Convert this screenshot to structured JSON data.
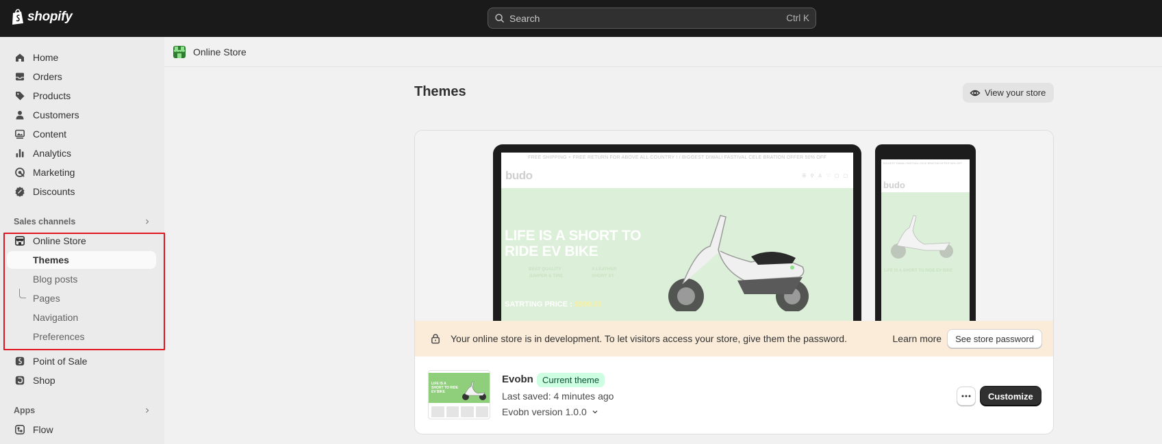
{
  "topbar": {
    "brand": "shopify",
    "search_placeholder": "Search",
    "search_shortcut": "Ctrl K"
  },
  "sidebar": {
    "items": [
      {
        "label": "Home",
        "icon": "home-icon"
      },
      {
        "label": "Orders",
        "icon": "inbox-icon"
      },
      {
        "label": "Products",
        "icon": "tag-icon"
      },
      {
        "label": "Customers",
        "icon": "person-icon"
      },
      {
        "label": "Content",
        "icon": "image-icon"
      },
      {
        "label": "Analytics",
        "icon": "bar-chart-icon"
      },
      {
        "label": "Marketing",
        "icon": "target-icon"
      },
      {
        "label": "Discounts",
        "icon": "discount-icon"
      }
    ],
    "sales_channels_label": "Sales channels",
    "online_store": {
      "label": "Online Store",
      "icon": "store-icon",
      "subitems": [
        "Themes",
        "Blog posts",
        "Pages",
        "Navigation",
        "Preferences"
      ],
      "active": "Themes"
    },
    "channels": [
      {
        "label": "Point of Sale",
        "icon": "pos-icon"
      },
      {
        "label": "Shop",
        "icon": "shop-icon"
      }
    ],
    "apps_label": "Apps",
    "apps": [
      {
        "label": "Flow",
        "icon": "flow-icon"
      }
    ],
    "highlight_color": "#e0141e"
  },
  "breadcrumb": {
    "label": "Online Store"
  },
  "main": {
    "title": "Themes",
    "view_store_label": "View your store",
    "preview": {
      "announcement": "FREE SHIPPING + FREE RETURN FOR ABOVE ALL COUNTRY !     /     BIGGEST DIWALI FASTIVAL CELE BRATION OFFER 50% OFF",
      "brand": "budo",
      "hero_title": "LIFE IS A SHORT TO RIDE EV BIKE",
      "feature_1": "BEST QUALITY JUMPER & TIRE",
      "feature_2": "A LEATHER SHORT ST",
      "price_label": "SATRTING PRICE :",
      "price_value": "$999.00",
      "phone_announcement": "BIGGEST DIWALI FASTIVAL CELE BRATION OFFER 50% OFF",
      "phone_hero_title": "LIFE IS A SHORT TO RIDE EV BIKE",
      "hero_color": "#dcefd8"
    },
    "dev_banner": {
      "text": "Your online store is in development. To let visitors access your store, give them the password.",
      "learn_more": "Learn more",
      "button": "See store password",
      "bg_color": "#fbecd9"
    },
    "theme": {
      "name": "Evobn",
      "badge": "Current theme",
      "last_saved": "Last saved: 4 minutes ago",
      "version": "Evobn version 1.0.0",
      "thumb_text": "LIFE IS A SHORT TO RIDE EV BIKE",
      "customize_label": "Customize",
      "badge_color": "#cdfee1"
    }
  }
}
